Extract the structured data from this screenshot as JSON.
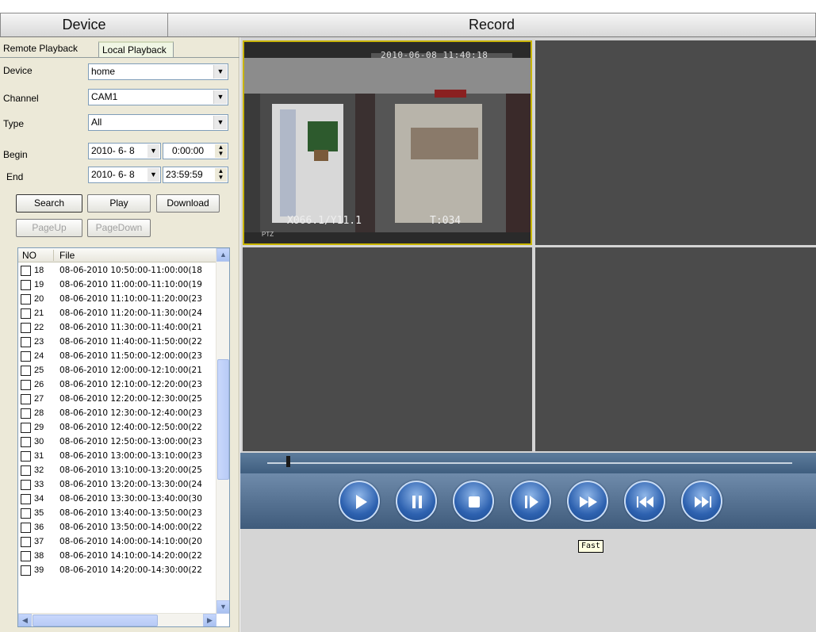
{
  "header": {
    "device_title": "Device",
    "record_title": "Record"
  },
  "tabs": {
    "remote": "Remote Playback",
    "local": "Local Playback"
  },
  "filters": {
    "device_label": "Device",
    "device_value": "home",
    "channel_label": "Channel",
    "channel_value": "CAM1",
    "type_label": "Type",
    "type_value": "All",
    "begin_label": "Begin",
    "begin_date": "2010- 6- 8",
    "begin_time": "0:00:00",
    "end_label": "End",
    "end_date": "2010- 6- 8",
    "end_time": "23:59:59"
  },
  "buttons": {
    "search": "Search",
    "play": "Play",
    "download": "Download",
    "pageup": "PageUp",
    "pagedown": "PageDown"
  },
  "list": {
    "col_no": "NO",
    "col_file": "File",
    "rows": [
      {
        "no": "18",
        "file": "08-06-2010 10:50:00-11:00:00(18"
      },
      {
        "no": "19",
        "file": "08-06-2010 11:00:00-11:10:00(19"
      },
      {
        "no": "20",
        "file": "08-06-2010 11:10:00-11:20:00(23"
      },
      {
        "no": "21",
        "file": "08-06-2010 11:20:00-11:30:00(24"
      },
      {
        "no": "22",
        "file": "08-06-2010 11:30:00-11:40:00(21"
      },
      {
        "no": "23",
        "file": "08-06-2010 11:40:00-11:50:00(22"
      },
      {
        "no": "24",
        "file": "08-06-2010 11:50:00-12:00:00(23"
      },
      {
        "no": "25",
        "file": "08-06-2010 12:00:00-12:10:00(21"
      },
      {
        "no": "26",
        "file": "08-06-2010 12:10:00-12:20:00(23"
      },
      {
        "no": "27",
        "file": "08-06-2010 12:20:00-12:30:00(25"
      },
      {
        "no": "28",
        "file": "08-06-2010 12:30:00-12:40:00(23"
      },
      {
        "no": "29",
        "file": "08-06-2010 12:40:00-12:50:00(22"
      },
      {
        "no": "30",
        "file": "08-06-2010 12:50:00-13:00:00(23"
      },
      {
        "no": "31",
        "file": "08-06-2010 13:00:00-13:10:00(23"
      },
      {
        "no": "32",
        "file": "08-06-2010 13:10:00-13:20:00(25"
      },
      {
        "no": "33",
        "file": "08-06-2010 13:20:00-13:30:00(24"
      },
      {
        "no": "34",
        "file": "08-06-2010 13:30:00-13:40:00(30"
      },
      {
        "no": "35",
        "file": "08-06-2010 13:40:00-13:50:00(23"
      },
      {
        "no": "36",
        "file": "08-06-2010 13:50:00-14:00:00(22"
      },
      {
        "no": "37",
        "file": "08-06-2010 14:00:00-14:10:00(20"
      },
      {
        "no": "38",
        "file": "08-06-2010 14:10:00-14:20:00(22"
      },
      {
        "no": "39",
        "file": "08-06-2010 14:20:00-14:30:00(22"
      }
    ]
  },
  "video": {
    "timestamp": "2010-06-08 11:40:18",
    "xy": "X066.1/Y11.1",
    "t": "T:034",
    "ptz": "PTZ"
  },
  "controls": {
    "icons": [
      "play-icon",
      "pause-icon",
      "stop-icon",
      "step-forward-icon",
      "fast-forward-icon",
      "skip-back-icon",
      "skip-forward-icon"
    ],
    "tooltip": "Fast"
  }
}
